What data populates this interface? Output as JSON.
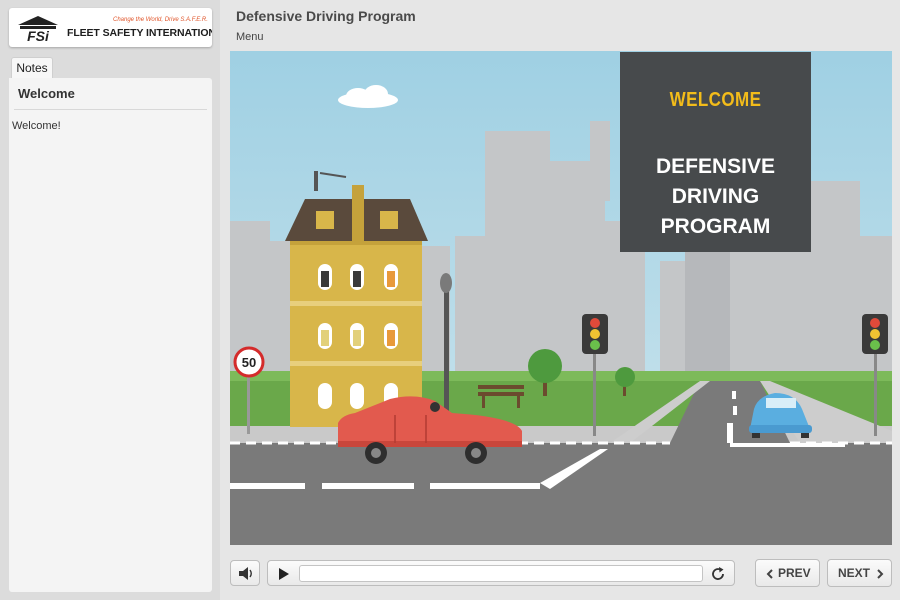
{
  "logo": {
    "tagline": "Change the World, Drive S.A.F.E.R.",
    "name": "FLEET SAFETY INTERNATIONAL",
    "mark_text": "FSi",
    "icon": "fsi-logo-icon",
    "tagline_color": "#e0552a"
  },
  "sidebar": {
    "tabs": [
      {
        "label": "Notes"
      }
    ],
    "notes": {
      "title": "Welcome",
      "body": "Welcome!"
    }
  },
  "header": {
    "title": "Defensive Driving Program",
    "menu_label": "Menu"
  },
  "slide": {
    "heading": "WELCOME",
    "body_lines": [
      "DEFENSIVE",
      "DRIVING",
      "PROGRAM"
    ],
    "heading_color": "#f3bc1a",
    "panel_color": "#474a4c",
    "speed_sign": "50"
  },
  "player": {
    "volume_icon": "volume-icon",
    "play_icon": "play-icon",
    "replay_icon": "replay-icon",
    "progress": 0.0,
    "prev_label": "PREV",
    "next_label": "NEXT",
    "prev_icon": "chevron-left-icon",
    "next_icon": "chevron-right-icon"
  }
}
